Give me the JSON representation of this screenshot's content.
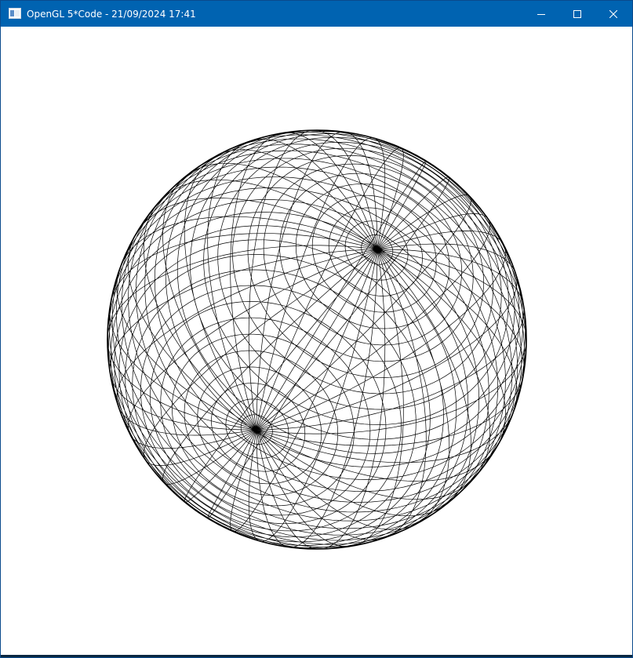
{
  "window": {
    "title": "OpenGL 5*Code - 21/09/2024 17:41",
    "app_icon": "window-app-icon",
    "caption_buttons": [
      {
        "name": "minimize-icon",
        "glyph": "minimize"
      },
      {
        "name": "maximize-icon",
        "glyph": "maximize"
      },
      {
        "name": "close-icon",
        "glyph": "close"
      }
    ],
    "titlebar_color": "#0063b1"
  },
  "scene": {
    "object": "wireframe-sphere",
    "line_color": "#000000",
    "background_color": "#ffffff",
    "slices": 40,
    "stacks": 40
  }
}
